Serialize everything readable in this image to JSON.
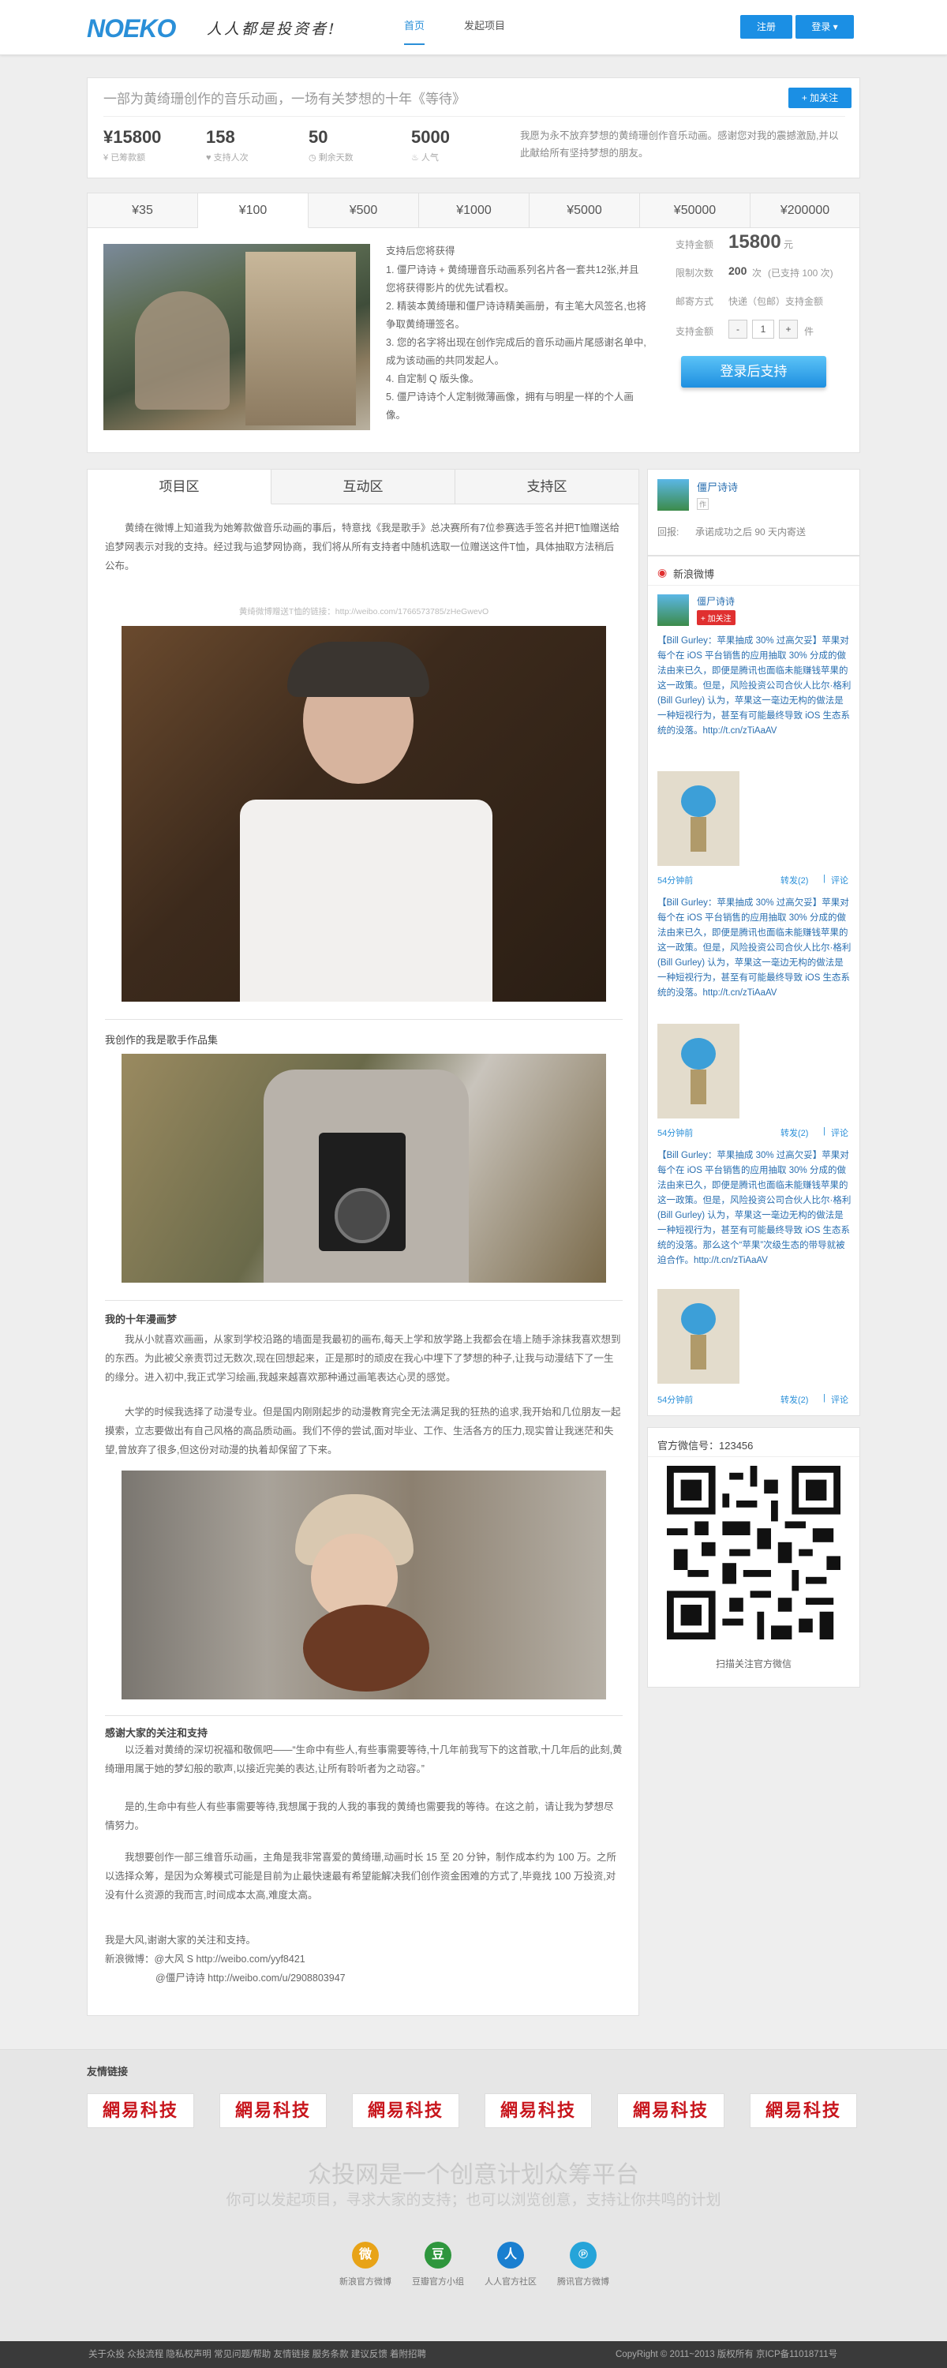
{
  "header": {
    "logo": "NOEKO",
    "slogan": "人人都是投资者!",
    "nav": [
      "首页",
      "发起项目"
    ],
    "register": "注册",
    "login": "登录 ▾"
  },
  "project": {
    "title": "一部为黄绮珊创作的音乐动画，一场有关梦想的十年《等待》",
    "follow": "+ 加关注",
    "stats": [
      {
        "value": "¥15800",
        "label": "已筹款额"
      },
      {
        "value": "158",
        "label": "支持人次"
      },
      {
        "value": "50",
        "label": "剩余天数"
      },
      {
        "value": "5000",
        "label": "人气"
      }
    ],
    "description": "我愿为永不放弃梦想的黄绮珊创作音乐动画。感谢您对我的震撼激励,并以此献给所有坚持梦想的朋友。"
  },
  "amounts": [
    "¥35",
    "¥100",
    "¥500",
    "¥1000",
    "¥5000",
    "¥50000",
    "¥200000"
  ],
  "reward": {
    "title": "支持后您将获得",
    "items": [
      "1. 僵尸诗诗 + 黄绮珊音乐动画系列名片各一套共12张,并且您将获得影片的优先试看权。",
      "2. 精装本黄绮珊和僵尸诗诗精美画册，有主笔大风签名,也将争取黄绮珊签名。",
      "3. 您的名字将出现在创作完成后的音乐动画片尾感谢名单中,成为该动画的共同发起人。",
      "4. 自定制 Q 版头像。",
      "5. 僵尸诗诗个人定制微薄画像，拥有与明星一样的个人画像。"
    ],
    "amount_label": "支持金额",
    "amount_value": "15800",
    "amount_unit": "元",
    "limit_label": "限制次数",
    "limit_value": "200",
    "limit_unit": "次",
    "limit_note": "(已支持 100 次)",
    "delivery_label": "邮寄方式",
    "delivery_value": "快递（包邮）支持金额",
    "count_label": "支持金额",
    "minus": "-",
    "count_value": "1",
    "plus": "+",
    "count_unit": "件",
    "button": "登录后支持"
  },
  "main": {
    "tabs": [
      "项目区",
      "互动区",
      "支持区"
    ],
    "intro": "黄绮在微博上知道我为她筹款做音乐动画的事后，特意找《我是歌手》总决赛所有7位参赛选手签名并把T恤赠送给追梦网表示对我的支持。经过我与追梦网协商，我们将从所有支持者中随机选取一位赠送这件T恤，具体抽取方法稍后公布。",
    "caption": "黄绮微博赠送T恤的链接：http://weibo.com/1766573785/zHeGwevO",
    "section1": "我创作的我是歌手作品集",
    "section2": "我的十年漫画梦",
    "para2": "我从小就喜欢画画，从家到学校沿路的墙面是我最初的画布,每天上学和放学路上我都会在墙上随手涂抹我喜欢想到的东西。为此被父亲责罚过无数次,现在回想起来，正是那时的顽皮在我心中埋下了梦想的种子,让我与动漫结下了一生的缘分。进入初中,我正式学习绘画,我越来越喜欢那种通过画笔表达心灵的感觉。",
    "para3": "大学的时候我选择了动漫专业。但是国内刚刚起步的动漫教育完全无法满足我的狂热的追求,我开始和几位朋友一起摸索，立志要做出有自己风格的高品质动画。我们不停的尝试,面对毕业、工作、生活各方的压力,现实曾让我迷茫和失望,曾放弃了很多,但这份对动漫的执着却保留了下来。",
    "section3": "感谢大家的关注和支持",
    "para4": "以泛着对黄绮的深切祝福和敬佩吧——“生命中有些人,有些事需要等待,十几年前我写下的这首歌,十几年后的此刻,黄绮珊用属于她的梦幻般的歌声,以接近完美的表达,让所有聆听者为之动容。”",
    "para5": "是的,生命中有些人有些事需要等待,我想属于我的人我的事我的黄绮也需要我的等待。在这之前，请让我为梦想尽情努力。",
    "para6": "我想要创作一部三维音乐动画，主角是我非常喜爱的黄绮珊,动画时长 15 至 20 分钟，制作成本约为 100 万。之所以选择众筹，是因为众筹模式可能是目前为止最快速最有希望能解决我们创作资金困难的方式了,毕竟找 100 万投资,对没有什么资源的我而言,时间成本太高,难度太高。",
    "sign1": "我是大风,谢谢大家的关注和支持。",
    "sign2": "新浪微博：@大风 S http://weibo.com/yyf8421",
    "sign3": "@僵尸诗诗 http://weibo.com/u/2908803947"
  },
  "sidebar": {
    "author": "僵尸诗诗",
    "author_badge": "作",
    "return_label": "回报:",
    "return_text": "承诺成功之后 90 天内寄送",
    "weibo_title": "新浪微博",
    "weibo_follow": "+ 加关注",
    "posts": [
      {
        "text": "【Bill Gurley：苹果抽成 30% 过高欠妥】苹果对每个在 iOS 平台销售的应用抽取 30% 分成的做法由来已久，即便是腾讯也面临未能赚钱苹果的这一政策。但是，风险投资公司合伙人比尔·格利 (Bill Gurley) 认为，苹果这一毫边无构的做法是一种短视行为，甚至有可能最终导致 iOS 生态系统的没落。http://t.cn/zTiAaAV",
        "time": "54分钟前",
        "repost": "转发(2)",
        "comment": "评论"
      },
      {
        "text": "【Bill Gurley：苹果抽成 30% 过高欠妥】苹果对每个在 iOS 平台销售的应用抽取 30% 分成的做法由来已久，即便是腾讯也面临未能赚钱苹果的这一政策。但是，风险投资公司合伙人比尔·格利 (Bill Gurley) 认为，苹果这一毫边无构的做法是一种短视行为，甚至有可能最终导致 iOS 生态系统的没落。http://t.cn/zTiAaAV",
        "time": "54分钟前",
        "repost": "转发(2)",
        "comment": "评论"
      },
      {
        "text": "【Bill Gurley：苹果抽成 30% 过高欠妥】苹果对每个在 iOS 平台销售的应用抽取 30% 分成的做法由来已久，即便是腾讯也面临未能赚钱苹果的这一政策。但是，风险投资公司合伙人比尔·格利 (Bill Gurley) 认为，苹果这一毫边无构的做法是一种短视行为，甚至有可能最终导致 iOS 生态系统的没落。那么这个“苹果”次级生态的带导就被迫合作。http://t.cn/zTiAaAV",
        "time": "54分钟前",
        "repost": "转发(2)",
        "comment": "评论"
      }
    ],
    "wechat_title": "官方微信号：123456",
    "wechat_caption": "扫描关注官方微信"
  },
  "footer": {
    "links_title": "友情链接",
    "link_label": "網易科技",
    "slogan": "众投网是一个创意计划众筹平台",
    "subslogan": "你可以发起项目，寻求大家的支持；也可以浏览创意，支持让你共鸣的计划",
    "socials": [
      "新浪官方微博",
      "豆瓣官方小组",
      "人人官方社区",
      "腾讯官方微博"
    ],
    "bottom_links": "关于众投  众投流程  隐私权声明  常见问题/帮助  友情链接  服务条款  建议反馈  着附招聘",
    "copyright": "CopyRight © 2011~2013   版权所有   京ICP备11018711号"
  },
  "colors": {
    "accent": "#1b8fe4",
    "brand": "#2a8fd8",
    "weibo_red": "#e03030",
    "netease_red": "#c8161d"
  }
}
